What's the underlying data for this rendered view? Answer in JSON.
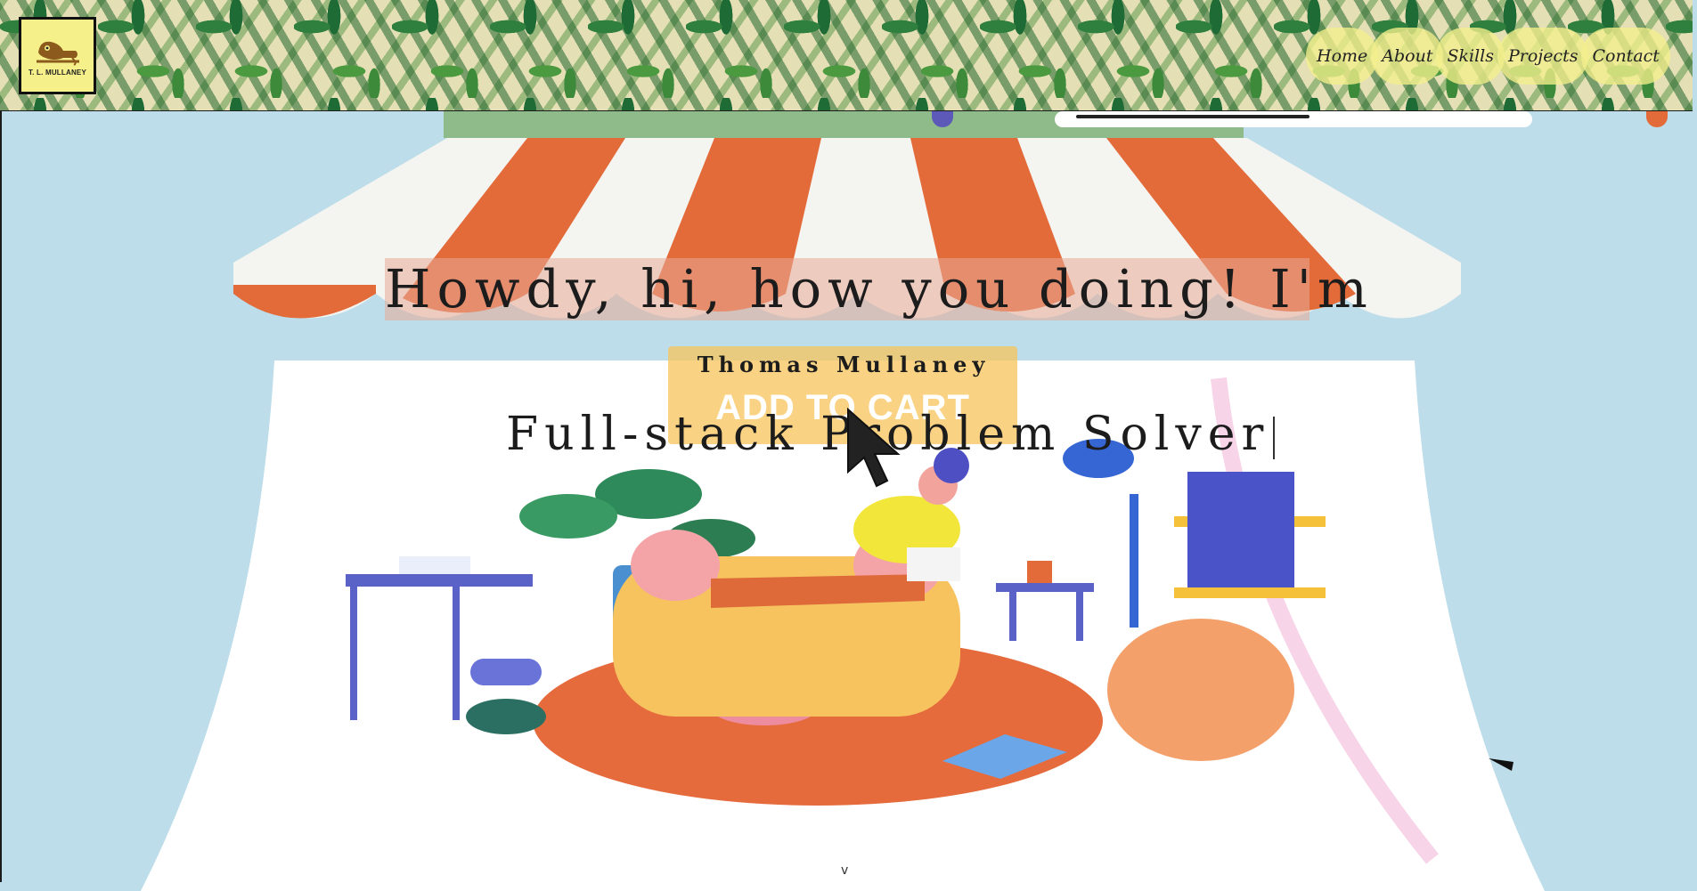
{
  "header": {
    "logo_text": "T. L. MULLANEY",
    "nav": [
      {
        "label": "Home"
      },
      {
        "label": "About"
      },
      {
        "label": "Skills"
      },
      {
        "label": "Projects"
      },
      {
        "label": "Contact"
      }
    ]
  },
  "hero": {
    "greeting": "Howdy, hi, how you doing! I'm",
    "name": "Thomas Mullaney",
    "illustration_button": "ADD TO CART",
    "tagline": "Full-stack Problem Solver",
    "scroll_indicator": "v"
  },
  "colors": {
    "background": "#bcdde9",
    "nav_pill": "#f4f08c",
    "awning_orange": "#e36b3a",
    "header_leaf_green": "#2f7f3e"
  }
}
